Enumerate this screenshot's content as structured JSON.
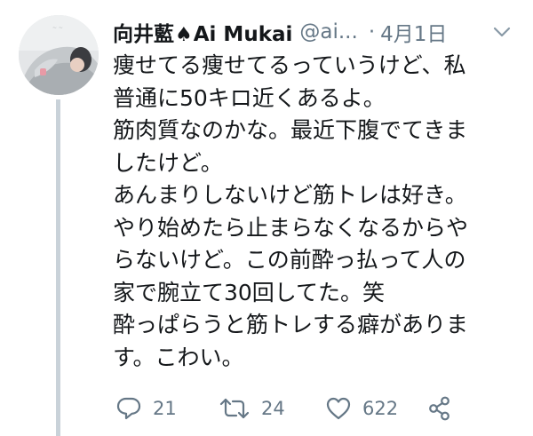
{
  "tweet": {
    "display_name": "向井藍",
    "spade": "♠",
    "display_name_suffix": "Ai Mukai",
    "handle": "@ai...",
    "separator": "·",
    "date": "4月1日",
    "lines": [
      "痩せてる痩せてるっていうけど、私",
      "普通に50キロ近くあるよ。",
      "筋肉質なのかな。最近下腹でてきま",
      "したけど。",
      "あんまりしないけど筋トレは好き。",
      "やり始めたら止まらなくなるからや",
      "らないけど。この前酔っ払って人の",
      "家で腕立て30回してた。笑",
      "酔っぱらうと筋トレする癖がありま",
      "す。こわい。"
    ]
  },
  "actions": {
    "reply_count": "21",
    "retweet_count": "24",
    "like_count": "622"
  },
  "icons": {
    "avatar": "avatar-photo",
    "menu": "chevron-down-icon",
    "reply": "reply-icon",
    "retweet": "retweet-icon",
    "like": "heart-icon",
    "share": "share-icon"
  },
  "colors": {
    "text": "#14171a",
    "muted": "#657786",
    "thread_line": "#c9d2d9"
  }
}
